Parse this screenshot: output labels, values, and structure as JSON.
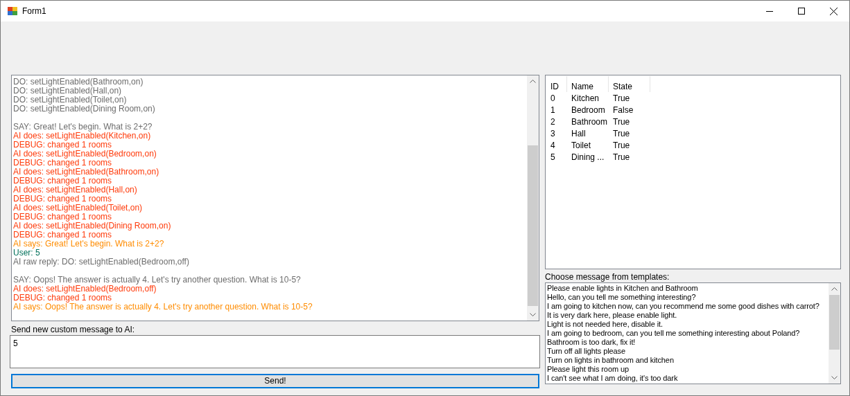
{
  "window": {
    "title": "Form1"
  },
  "log": {
    "lines": [
      {
        "kind": "plain",
        "text": "DO: setLightEnabled(Bathroom,on)"
      },
      {
        "kind": "plain",
        "text": "DO: setLightEnabled(Hall,on)"
      },
      {
        "kind": "plain",
        "text": "DO: setLightEnabled(Toilet,on)"
      },
      {
        "kind": "plain",
        "text": "DO: setLightEnabled(Dining Room,on)"
      },
      {
        "kind": "blank"
      },
      {
        "kind": "plain",
        "text": "SAY: Great! Let's begin. What is 2+2?"
      },
      {
        "kind": "action",
        "text": "AI does: setLightEnabled(Kitchen,on)"
      },
      {
        "kind": "action",
        "text": "DEBUG: changed 1 rooms"
      },
      {
        "kind": "action",
        "text": "AI does: setLightEnabled(Bedroom,on)"
      },
      {
        "kind": "action",
        "text": "DEBUG: changed 1 rooms"
      },
      {
        "kind": "action",
        "text": "AI does: setLightEnabled(Bathroom,on)"
      },
      {
        "kind": "action",
        "text": "DEBUG: changed 1 rooms"
      },
      {
        "kind": "action",
        "text": "AI does: setLightEnabled(Hall,on)"
      },
      {
        "kind": "action",
        "text": "DEBUG: changed 1 rooms"
      },
      {
        "kind": "action",
        "text": "AI does: setLightEnabled(Toilet,on)"
      },
      {
        "kind": "action",
        "text": "DEBUG: changed 1 rooms"
      },
      {
        "kind": "action",
        "text": "AI does: setLightEnabled(Dining Room,on)"
      },
      {
        "kind": "action",
        "text": "DEBUG: changed 1 rooms"
      },
      {
        "kind": "ai",
        "text": "AI says: Great! Let's begin. What is 2+2?"
      },
      {
        "kind": "user",
        "text": "User: 5"
      },
      {
        "kind": "plain",
        "text": "AI raw reply: DO: setLightEnabled(Bedroom,off)"
      },
      {
        "kind": "blank"
      },
      {
        "kind": "plain",
        "text": "SAY: Oops! The answer is actually 4. Let's try another question. What is 10-5?"
      },
      {
        "kind": "action",
        "text": "AI does: setLightEnabled(Bedroom,off)"
      },
      {
        "kind": "action",
        "text": "DEBUG: changed 1 rooms"
      },
      {
        "kind": "ai",
        "text": "AI says: Oops! The answer is actually 4. Let's try another question. What is 10-5?"
      }
    ]
  },
  "custom_message": {
    "label": "Send new custom message to AI:",
    "value": "5"
  },
  "send_button": "Send!",
  "rooms": {
    "columns": [
      "ID",
      "Name",
      "State"
    ],
    "rows": [
      [
        "0",
        "Kitchen",
        "True"
      ],
      [
        "1",
        "Bedroom",
        "False"
      ],
      [
        "2",
        "Bathroom",
        "True"
      ],
      [
        "3",
        "Hall",
        "True"
      ],
      [
        "4",
        "Toilet",
        "True"
      ],
      [
        "5",
        "Dining ...",
        "True"
      ]
    ]
  },
  "templates": {
    "label": "Choose message from templates:",
    "items": [
      "Please enable lights in Kitchen and Bathroom",
      "Hello, can you tell me something interesting?",
      "I am going to kitchen now, can you recommend me some good dishes with carrot?",
      "It is very dark here, please enable light.",
      "Light is not needed here, disable it.",
      "I am going to bedroom, can you tell me something interesting about Poland?",
      "Bathroom is too dark, fix it!",
      "Turn off all lights please",
      "Turn on lights in bathroom and kitchen",
      "Please light this room up",
      "I can't see what I am doing, it's too dark"
    ]
  }
}
